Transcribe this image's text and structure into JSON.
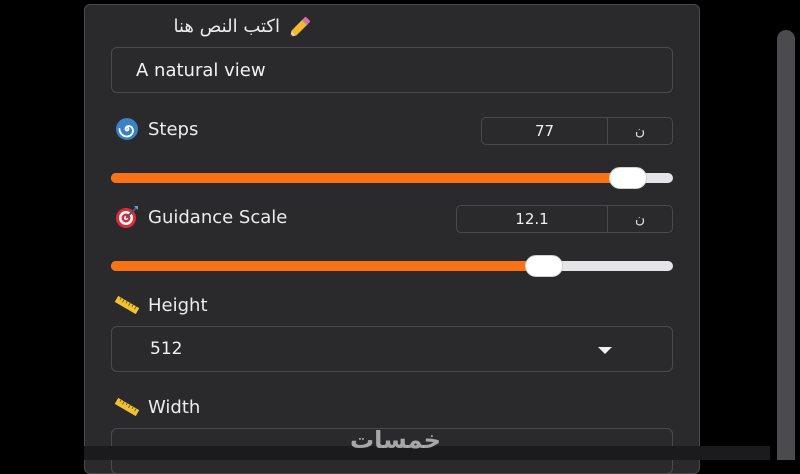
{
  "prompt": {
    "label": "اكتب النص هنا",
    "value": "A natural view",
    "icon": "pencil-icon"
  },
  "steps": {
    "label": "Steps",
    "value": "77",
    "reset_label": "ن",
    "icon": "spiral-icon",
    "progress": 0.92
  },
  "guidance": {
    "label": "Guidance Scale",
    "value": "12.1",
    "reset_label": "ن",
    "icon": "target-icon",
    "progress": 0.77
  },
  "height": {
    "label": "Height",
    "value": "512",
    "icon": "ruler-icon"
  },
  "width": {
    "label": "Width",
    "icon": "ruler-icon"
  },
  "watermark": "خمسات",
  "colors": {
    "accent": "#f97316",
    "panel": "#2a2a2c",
    "border": "#4a4a4e",
    "track": "#e4e4e8"
  }
}
